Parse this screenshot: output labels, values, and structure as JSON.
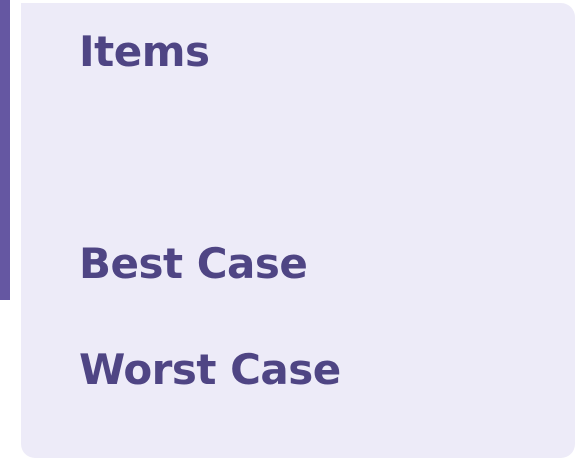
{
  "panel": {
    "items_label": "Items",
    "best_case_label": "Best Case",
    "worst_case_label": "Worst Case"
  },
  "colors": {
    "accent": "#6557a2",
    "panel_background": "#edebf8",
    "text": "#4f4584"
  }
}
